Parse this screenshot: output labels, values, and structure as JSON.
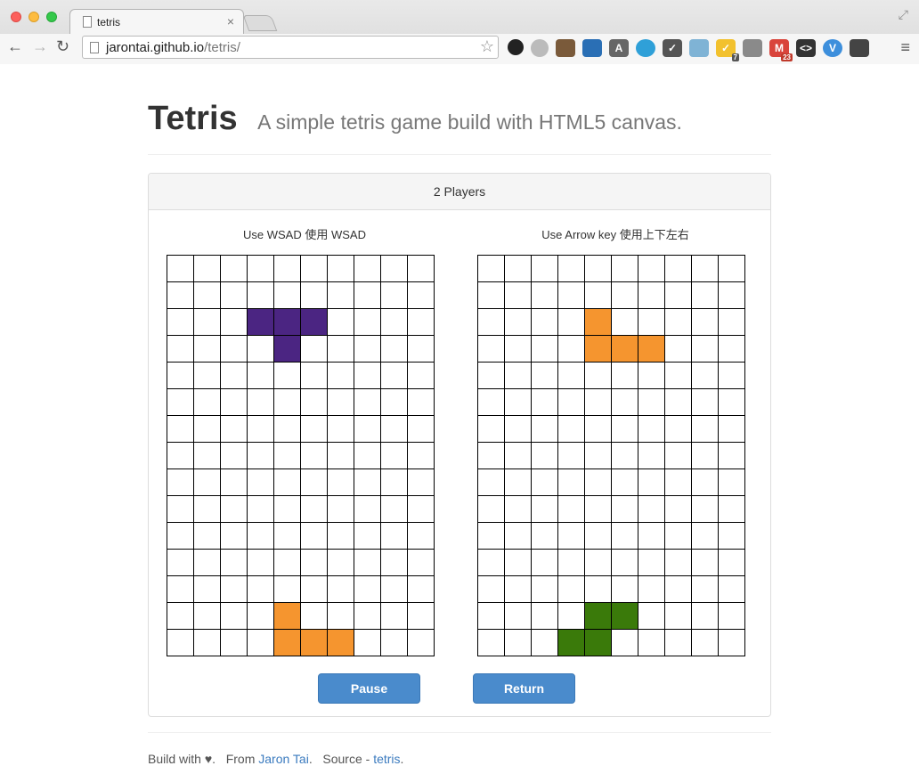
{
  "browser": {
    "tab_title": "tetris",
    "url_host": "jarontai.github.io",
    "url_path": "/tetris/"
  },
  "header": {
    "title": "Tetris",
    "subtitle": "A simple tetris game build with HTML5 canvas."
  },
  "panel": {
    "heading": "2 Players"
  },
  "players": [
    {
      "label": "Use WSAD 使用 WSAD",
      "cells": [
        {
          "row": 2,
          "col": 3,
          "color": "#4b2582"
        },
        {
          "row": 2,
          "col": 4,
          "color": "#4b2582"
        },
        {
          "row": 2,
          "col": 5,
          "color": "#4b2582"
        },
        {
          "row": 3,
          "col": 4,
          "color": "#4b2582"
        },
        {
          "row": 13,
          "col": 4,
          "color": "#f5952f"
        },
        {
          "row": 14,
          "col": 4,
          "color": "#f5952f"
        },
        {
          "row": 14,
          "col": 5,
          "color": "#f5952f"
        },
        {
          "row": 14,
          "col": 6,
          "color": "#f5952f"
        }
      ]
    },
    {
      "label": "Use Arrow key 使用上下左右",
      "cells": [
        {
          "row": 2,
          "col": 4,
          "color": "#f5952f"
        },
        {
          "row": 3,
          "col": 4,
          "color": "#f5952f"
        },
        {
          "row": 3,
          "col": 5,
          "color": "#f5952f"
        },
        {
          "row": 3,
          "col": 6,
          "color": "#f5952f"
        },
        {
          "row": 13,
          "col": 4,
          "color": "#3a7a0a"
        },
        {
          "row": 13,
          "col": 5,
          "color": "#3a7a0a"
        },
        {
          "row": 14,
          "col": 3,
          "color": "#3a7a0a"
        },
        {
          "row": 14,
          "col": 4,
          "color": "#3a7a0a"
        }
      ]
    }
  ],
  "board": {
    "rows": 15,
    "cols": 10
  },
  "buttons": {
    "pause": "Pause",
    "return": "Return"
  },
  "footer": {
    "build_text": "Build with",
    "from_text": "From",
    "author": "Jaron Tai",
    "source_text": "Source -",
    "source_link": "tetris"
  },
  "colors": {
    "button": "#4a8bcc",
    "link": "#3b7bbf"
  }
}
